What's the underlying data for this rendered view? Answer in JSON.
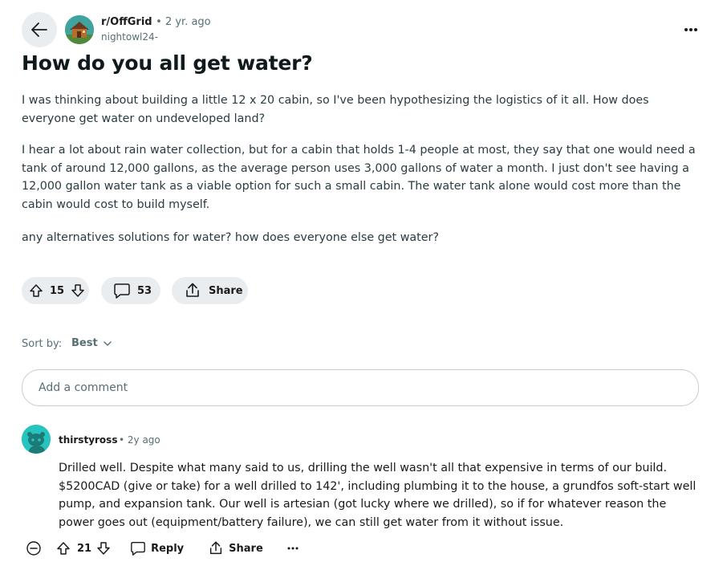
{
  "post": {
    "subreddit": "r/OffGrid",
    "age": "2 yr. ago",
    "author": "nightowl24-",
    "title": "How do you all get water?",
    "paragraphs": [
      "I was thinking about building a little 12 x 20 cabin, so I've been hypothesizing the logistics of it all. How does everyone get water on undeveloped land?",
      "I hear a lot about rain water collection, but for a cabin that holds 1-4 people at most, they say that one would need a tank of around 12,000 gallons, as the average person uses 3,000 gallons of water a month. I just don't see having a 12,000 gallon water tank as a viable option for such a small cabin. The water tank alone would cost more than the cabin would cost to build myself.",
      "any alternatives solutions for water? how does everyone else get water?"
    ],
    "votes": "15",
    "comments_count": "53",
    "share_label": "Share"
  },
  "sort": {
    "label": "Sort by:",
    "value": "Best"
  },
  "comment_input": {
    "placeholder": "Add a comment"
  },
  "comments": [
    {
      "user": "thirstyross",
      "age": "2y ago",
      "text": "Drilled well. Despite what many said to us, drilling the well wasn't all that expensive in terms of our build. $5200CAD (give or take) for a well drilled to 142', including plumbing it to the house, a grundfos soft-start well pump, and expansion tank. Our well is artesian (got lucky where we drilled), so if for whatever reason the power goes out (equipment/battery failure), we can still get water from it without issue.",
      "votes": "21",
      "reply_label": "Reply",
      "share_label": "Share"
    }
  ],
  "colors": {
    "pill_bg": "#eaedef",
    "muted": "#576f76",
    "comment_avatar": "#27c4bf"
  }
}
